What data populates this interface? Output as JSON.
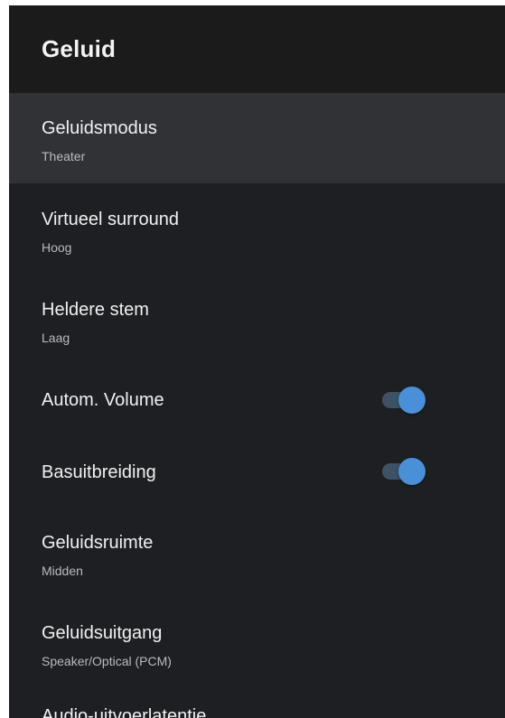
{
  "header": {
    "title": "Geluid"
  },
  "items": [
    {
      "title": "Geluidsmodus",
      "subtitle": "Theater",
      "selected": true
    },
    {
      "title": "Virtueel surround",
      "subtitle": "Hoog"
    },
    {
      "title": "Heldere stem",
      "subtitle": "Laag"
    },
    {
      "title": "Autom. Volume",
      "toggle": true
    },
    {
      "title": "Basuitbreiding",
      "toggle": true
    },
    {
      "title": "Geluidsruimte",
      "subtitle": "Midden"
    },
    {
      "title": "Geluidsuitgang",
      "subtitle": "Speaker/Optical (PCM)"
    },
    {
      "title": "Audio-uitvoerlatentie"
    }
  ],
  "colors": {
    "background": "#1d1f22",
    "header": "#1b1b1c",
    "selected": "#303235",
    "accent": "#4a90d9",
    "track": "#3e5265"
  }
}
